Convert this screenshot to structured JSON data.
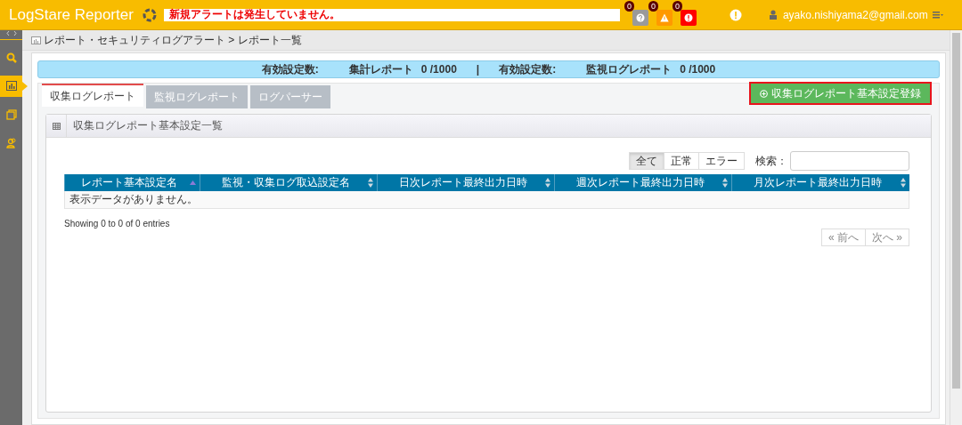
{
  "header": {
    "title": "LogStare Reporter",
    "alert_message": "新規アラートは発生していません。",
    "badges": [
      {
        "kind": "question",
        "count": "0"
      },
      {
        "kind": "warning",
        "count": "0"
      },
      {
        "kind": "error",
        "count": "0"
      }
    ],
    "user": "ayako.nishiyama2@gmail.com"
  },
  "sidebar": {
    "items": [
      {
        "kind": "search",
        "selected": false
      },
      {
        "kind": "report",
        "selected": true
      },
      {
        "kind": "book",
        "selected": false
      },
      {
        "kind": "users",
        "selected": false
      }
    ]
  },
  "breadcrumb": "レポート・セキュリティログアラート > レポート一覧",
  "summary": {
    "groups": [
      {
        "label": "有効設定数:",
        "name": "集計レポート",
        "count": "0 /1000"
      },
      {
        "label": "有効設定数:",
        "name": "監視ログレポート",
        "count": "0 /1000"
      }
    ],
    "separator": "|"
  },
  "tabs": [
    {
      "label": "収集ログレポート",
      "selected": true
    },
    {
      "label": "監視ログレポート",
      "selected": false
    },
    {
      "label": "ログパーサー",
      "selected": false
    }
  ],
  "add_button": "収集ログレポート基本設定登録",
  "panel": {
    "title": "収集ログレポート基本設定一覧",
    "filters": [
      {
        "label": "全て",
        "selected": true
      },
      {
        "label": "正常",
        "selected": false
      },
      {
        "label": "エラー",
        "selected": false
      }
    ],
    "search_label": "検索：",
    "table": {
      "columns": [
        {
          "label": "レポート基本設定名",
          "kind": "sorted"
        },
        {
          "label": "監視・収集ログ取込設定名",
          "kind": "sortable"
        },
        {
          "label": "日次レポート最終出力日時",
          "kind": "sortable"
        },
        {
          "label": "週次レポート最終出力日時",
          "kind": "sortable"
        },
        {
          "label": "月次レポート最終出力日時",
          "kind": "sortable"
        }
      ],
      "empty_message": "表示データがありません。"
    },
    "info": "Showing 0 to 0 of 0 entries",
    "pagination": {
      "previous": "« 前へ",
      "next": "次へ »"
    }
  }
}
